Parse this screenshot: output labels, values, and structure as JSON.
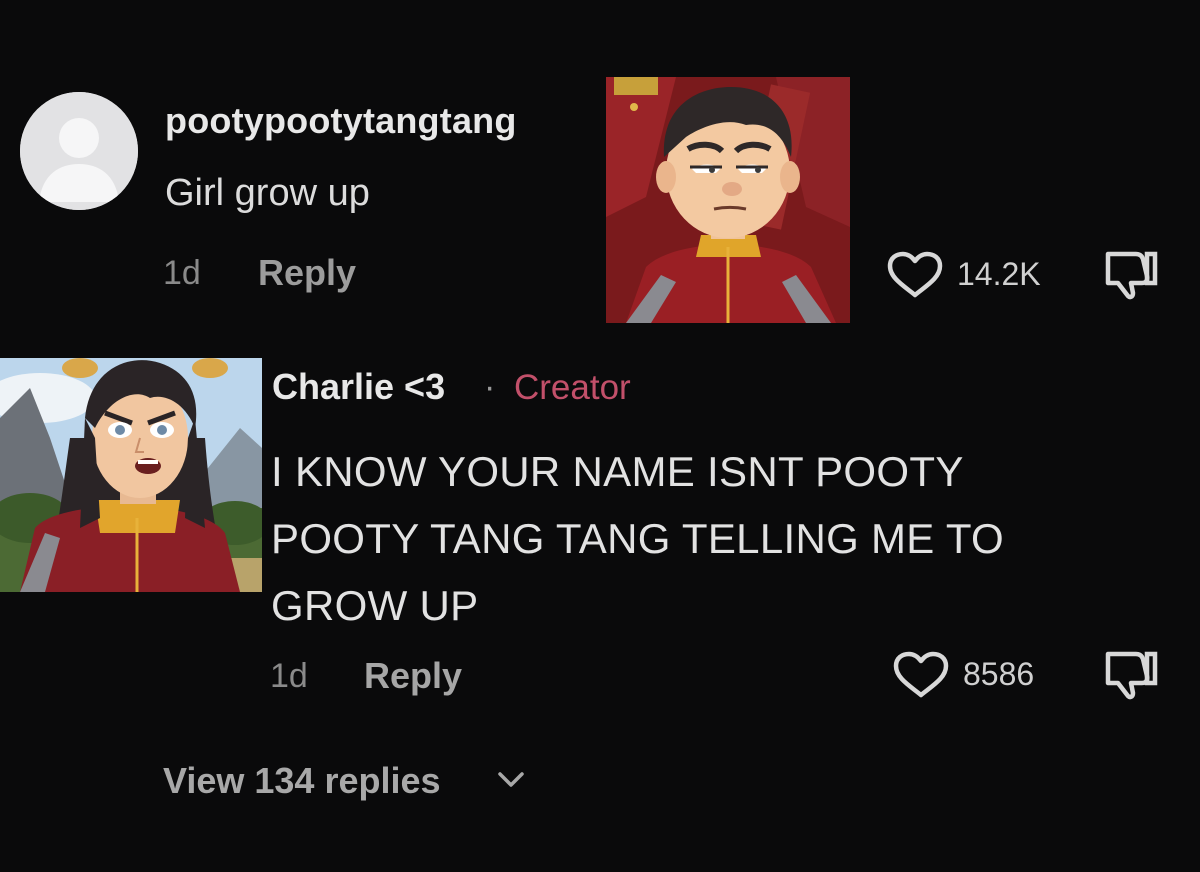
{
  "comments": [
    {
      "username": "pootypootytangtang",
      "text": "Girl grow up",
      "time": "1d",
      "reply_label": "Reply",
      "likes": "14.2K",
      "avatar_icon": "default-avatar-icon"
    },
    {
      "username": "Charlie <3",
      "separator": "·",
      "badge": "Creator",
      "text": "I KNOW YOUR NAME ISNT POOTY POOTY TANG TANG TELLING ME TO GROW UP",
      "time": "1d",
      "reply_label": "Reply",
      "likes": "8586"
    }
  ],
  "view_replies_label": "View 134 replies",
  "colors": {
    "background": "#0a0a0b",
    "creator_badge": "#c2506a",
    "secondary_text": "#8a8a8a"
  },
  "icons": [
    "heart-icon",
    "dislike-icon",
    "chevron-down-icon",
    "default-avatar-icon"
  ]
}
